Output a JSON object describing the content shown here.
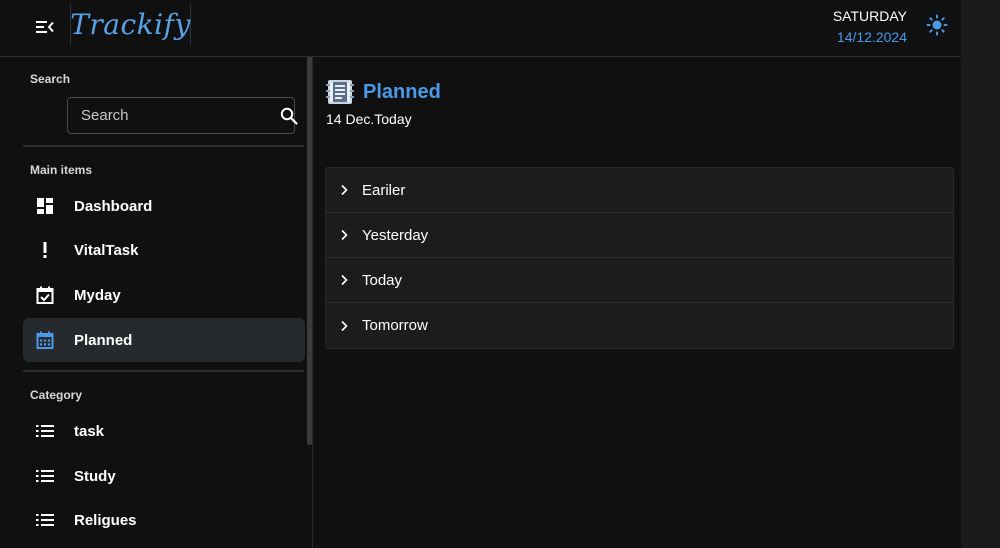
{
  "header": {
    "logo": "Trackify",
    "day": "SATURDAY",
    "date": "14/12.2024",
    "accent": "#4a9ae8"
  },
  "sidebar": {
    "search_label": "Search",
    "search_placeholder": "Search",
    "main_label": "Main items",
    "main_items": [
      {
        "label": "Dashboard",
        "icon": "dashboard-icon"
      },
      {
        "label": "VitalTask",
        "icon": "exclamation-icon"
      },
      {
        "label": "Myday",
        "icon": "calendar-check-icon"
      },
      {
        "label": "Planned",
        "icon": "calendar-icon",
        "active": true
      }
    ],
    "category_label": "Category",
    "category_items": [
      {
        "label": "task",
        "icon": "list-icon"
      },
      {
        "label": "Study",
        "icon": "list-icon"
      },
      {
        "label": "Religues",
        "icon": "list-icon"
      }
    ]
  },
  "main": {
    "title": "Planned",
    "subtitle": "14 Dec.Today",
    "sections": [
      {
        "label": "Eariler"
      },
      {
        "label": "Yesterday"
      },
      {
        "label": "Today"
      },
      {
        "label": "Tomorrow"
      }
    ]
  }
}
